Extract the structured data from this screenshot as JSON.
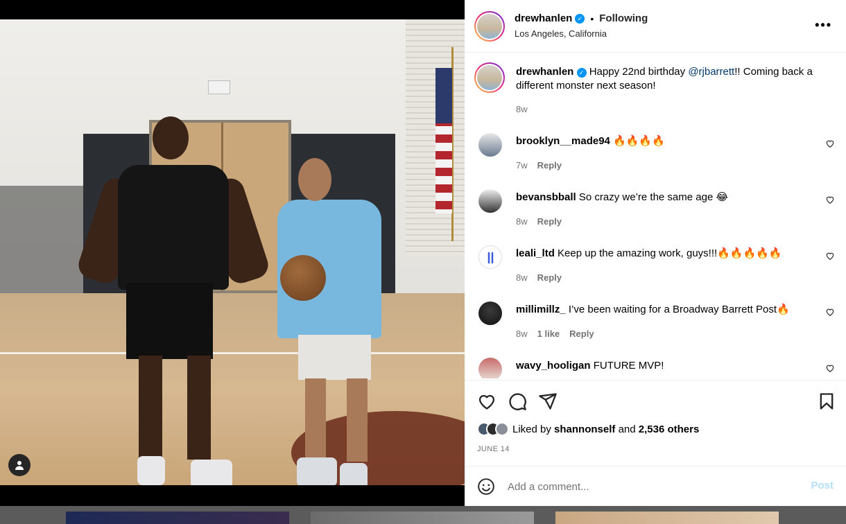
{
  "post": {
    "author": "drewhanlen",
    "verified_mark": "✓",
    "separator": "•",
    "follow_status": "Following",
    "location": "Los Angeles, California",
    "more_icon": "more-horizontal-icon",
    "more_label": "•••"
  },
  "caption": {
    "author": "drewhanlen",
    "text_before": "Happy 22nd birthday ",
    "mention": "@rjbarrett",
    "text_after": "!! Coming back a different monster next season!",
    "time": "8w"
  },
  "comments": [
    {
      "username": "brooklyn__made94",
      "text": "🔥🔥🔥🔥",
      "time": "7w",
      "likes": "",
      "reply": "Reply"
    },
    {
      "username": "bevansbball",
      "text": "So crazy we’re the same age 😂",
      "time": "8w",
      "likes": "",
      "reply": "Reply"
    },
    {
      "username": "leali_ltd",
      "text": "Keep up the amazing work, guys!!!🔥🔥🔥🔥🔥",
      "time": "8w",
      "likes": "",
      "reply": "Reply"
    },
    {
      "username": "millimillz_",
      "text": "I’ve been waiting for a Broadway Barrett Post🔥",
      "time": "8w",
      "likes": "1 like",
      "reply": "Reply"
    },
    {
      "username": "wavy_hooligan",
      "text": "FUTURE MVP!",
      "time": "",
      "likes": "",
      "reply": ""
    }
  ],
  "actions": {
    "like_icon": "heart-icon",
    "comment_icon": "comment-bubble-icon",
    "share_icon": "send-icon",
    "save_icon": "bookmark-icon"
  },
  "likes": {
    "prefix": "Liked by",
    "user": "shannonself",
    "conjunction": "and",
    "others": "2,536 others"
  },
  "date": "JUNE 14",
  "composer": {
    "placeholder": "Add a comment...",
    "post_label": "Post",
    "emoji_icon": "smiley-icon"
  },
  "colors": {
    "accent_blue": "#0095f6",
    "post_disabled": "#b2dffc",
    "mention": "#00376b",
    "muted": "#737373"
  }
}
